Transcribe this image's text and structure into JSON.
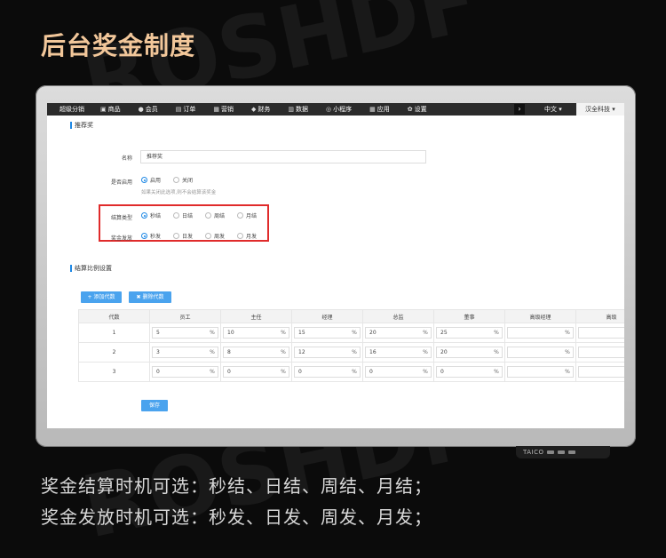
{
  "headline": "后台奖金制度",
  "nav": {
    "brand": "超级分销",
    "items": [
      {
        "label": "商品",
        "icon": "package-icon"
      },
      {
        "label": "会员",
        "icon": "user-icon"
      },
      {
        "label": "订单",
        "icon": "document-icon"
      },
      {
        "label": "营销",
        "icon": "gift-icon"
      },
      {
        "label": "财务",
        "icon": "money-bag-icon"
      },
      {
        "label": "数据",
        "icon": "bar-chart-icon"
      },
      {
        "label": "小程序",
        "icon": "mini-program-icon"
      },
      {
        "label": "应用",
        "icon": "grid-icon"
      },
      {
        "label": "设置",
        "icon": "gear-icon"
      }
    ],
    "lang": "中文",
    "org": "汉全科技"
  },
  "recommend": {
    "section_title": "推荐奖",
    "name_label": "名称",
    "name_value": "推荐奖",
    "enable_label": "是否启用",
    "enable_on": "启用",
    "enable_off": "关闭",
    "enable_hint": "如果关闭此选项,则不会结算该奖金",
    "settle_type_label": "结算类型",
    "settle_options": [
      "秒结",
      "日结",
      "周结",
      "月结"
    ],
    "payout_label": "奖金发放",
    "payout_options": [
      "秒发",
      "日发",
      "周发",
      "月发"
    ]
  },
  "ratio": {
    "section_title": "结算比例设置",
    "add_button": "+ 添加代数",
    "delete_button": "✖ 删除代数",
    "columns": [
      "代数",
      "员工",
      "主任",
      "经理",
      "总监",
      "董事",
      "高级经理",
      "高级"
    ],
    "rows": [
      {
        "gen": "1",
        "values": [
          "5",
          "10",
          "15",
          "20",
          "25",
          "",
          ""
        ]
      },
      {
        "gen": "2",
        "values": [
          "3",
          "8",
          "12",
          "16",
          "20",
          "",
          ""
        ]
      },
      {
        "gen": "3",
        "values": [
          "0",
          "0",
          "0",
          "0",
          "0",
          "",
          ""
        ]
      }
    ],
    "unit": "%",
    "save_button": "保存"
  },
  "device_brand": "TAICO",
  "captions": [
    "奖金结算时机可选：秒结、日结、周结、月结；",
    "奖金发放时机可选：秒发、日发、周发、月发；"
  ],
  "colors": {
    "accent": "#1e88e5",
    "highlight": "#e02b2b",
    "headline": "#f2c79a"
  }
}
